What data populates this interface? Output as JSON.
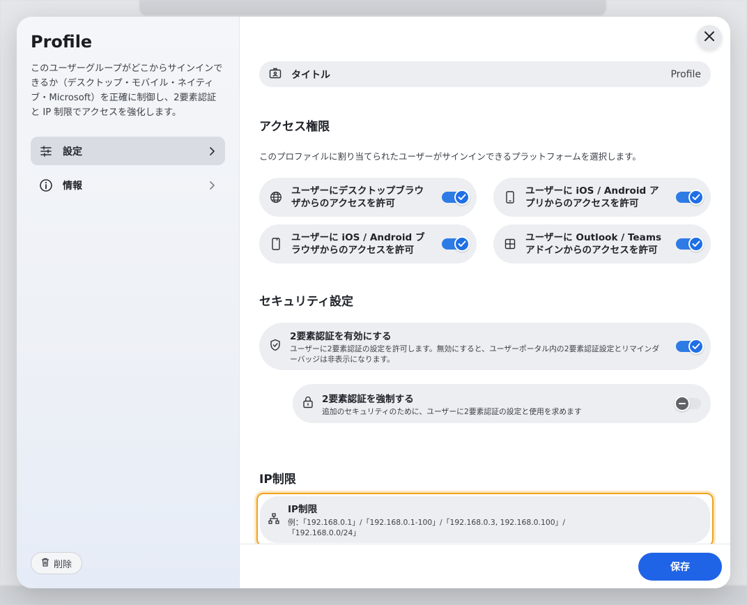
{
  "sidebar": {
    "title": "Profile",
    "description": "このユーザーグループがどこからサインインできるか（デスクトップ・モバイル・ネイティブ・Microsoft）を正確に制御し、2要素認証と IP 制限でアクセスを強化します。",
    "items": [
      {
        "label": "設定",
        "icon": "sliders-icon",
        "active": true
      },
      {
        "label": "情報",
        "icon": "info-icon",
        "active": false
      }
    ],
    "delete_label": "削除"
  },
  "main": {
    "title_row": {
      "label": "タイトル",
      "value": "Profile"
    },
    "access": {
      "title": "アクセス権限",
      "description": "このプロファイルに割り当てられたユーザーがサインインできるプラットフォームを選択します。",
      "options": [
        {
          "line1": "ユーザーにデスクトップブラウ",
          "line2": "ザからのアクセスを許可",
          "icon": "globe-icon",
          "enabled": true
        },
        {
          "line1": "ユーザーに iOS / Android ア",
          "line2": "プリからのアクセスを許可",
          "icon": "phone-icon",
          "enabled": true
        },
        {
          "line1": "ユーザーに iOS / Android ブ",
          "line2": "ラウザからのアクセスを許可",
          "icon": "tablet-icon",
          "enabled": true
        },
        {
          "line1": "ユーザーに Outlook / Teams",
          "line2": "アドインからのアクセスを許可",
          "icon": "grid-icon",
          "enabled": true
        }
      ]
    },
    "security": {
      "title": "セキュリティ設定",
      "two_factor": {
        "title": "2要素認証を有効にする",
        "line1": "ユーザーに2要素認証の設定を許可します。無効にすると、ユーザーポータル内の2要素認証設定とリマインダ",
        "line2": "ーバッジは非表示になります。",
        "enabled": true
      },
      "enforce": {
        "title": "2要素認証を強制する",
        "subtitle": "追加のセキュリティのために、ユーザーに2要素認証の設定と使用を求めます",
        "enabled": false
      }
    },
    "ip": {
      "title": "IP制限",
      "card_title": "IP制限",
      "line1": "例：「192.168.0.1」/「192.168.0.1-100」/「192.168.0.3, 192.168.0.100」/",
      "line2": "「192.168.0.0/24」"
    },
    "save_label": "保存"
  },
  "colors": {
    "accent": "#1f63e6",
    "toggle_on": "#2f7be6",
    "highlight": "#f0a21a"
  }
}
